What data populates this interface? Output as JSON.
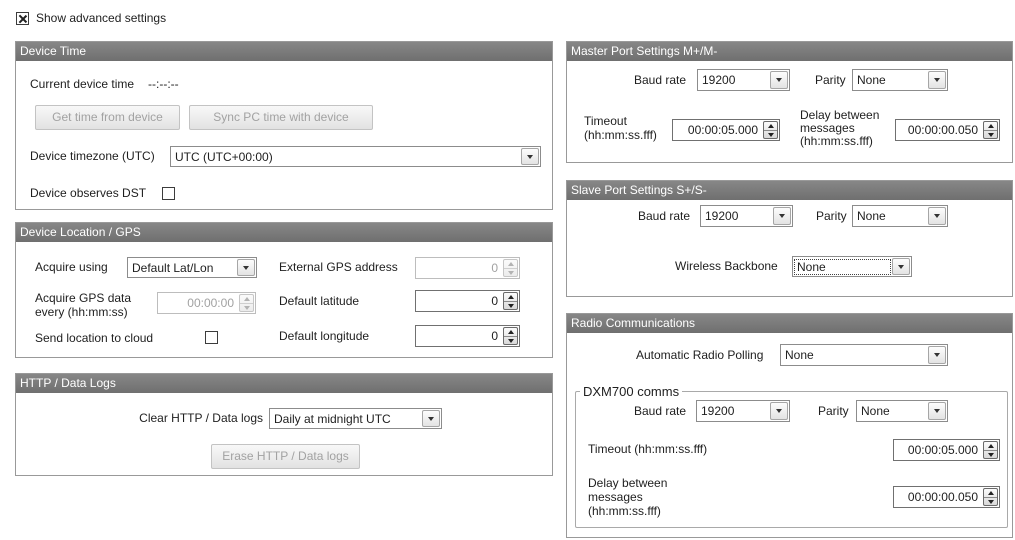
{
  "theme": {
    "panel_header_bg": "#6f6f6f",
    "panel_header_text": "#ffffff",
    "panel_border": "#999999",
    "label_text": "#1e1e1e",
    "disabled_text": "#a2a2a2"
  },
  "show_advanced": {
    "label": "Show advanced settings",
    "checked": true
  },
  "device_time": {
    "title": "Device Time",
    "current_time_label": "Current device time",
    "current_time_value": "--:--:--",
    "get_time_button": "Get time from device",
    "sync_time_button": "Sync PC time with device",
    "timezone_label": "Device timezone (UTC)",
    "timezone_value": "UTC (UTC+00:00)",
    "dst_label": "Device observes DST",
    "dst_checked": false
  },
  "location": {
    "title": "Device Location / GPS",
    "acquire_using_label": "Acquire using",
    "acquire_using_value": "Default Lat/Lon",
    "acquire_every_label": "Acquire GPS data every (hh:mm:ss)",
    "acquire_every_value": "00:00:00",
    "send_to_cloud_label": "Send location to cloud",
    "send_to_cloud_checked": false,
    "external_gps_label": "External GPS address",
    "external_gps_value": "0",
    "default_latitude_label": "Default latitude",
    "default_latitude_value": "0",
    "default_longitude_label": "Default longitude",
    "default_longitude_value": "0"
  },
  "http_logs": {
    "title": "HTTP / Data Logs",
    "clear_label": "Clear HTTP / Data logs",
    "clear_value": "Daily at midnight UTC",
    "erase_button": "Erase HTTP / Data logs"
  },
  "master_port": {
    "title": "Master Port Settings M+/M-",
    "baud_rate_label": "Baud rate",
    "baud_rate_value": "19200",
    "parity_label": "Parity",
    "parity_value": "None",
    "timeout_label": "Timeout (hh:mm:ss.fff)",
    "timeout_value": "00:00:05.000",
    "delay_label": "Delay between messages (hh:mm:ss.fff)",
    "delay_value": "00:00:00.050"
  },
  "slave_port": {
    "title": "Slave Port Settings S+/S-",
    "baud_rate_label": "Baud rate",
    "baud_rate_value": "19200",
    "parity_label": "Parity",
    "parity_value": "None",
    "wireless_backbone_label": "Wireless Backbone",
    "wireless_backbone_value": "None"
  },
  "radio": {
    "title": "Radio Communications",
    "polling_label": "Automatic Radio Polling",
    "polling_value": "None",
    "dxm700": {
      "legend": "DXM700 comms",
      "baud_rate_label": "Baud rate",
      "baud_rate_value": "19200",
      "parity_label": "Parity",
      "parity_value": "None",
      "timeout_label": "Timeout (hh:mm:ss.fff)",
      "timeout_value": "00:00:05.000",
      "delay_label": "Delay between messages (hh:mm:ss.fff)",
      "delay_value": "00:00:00.050"
    }
  }
}
